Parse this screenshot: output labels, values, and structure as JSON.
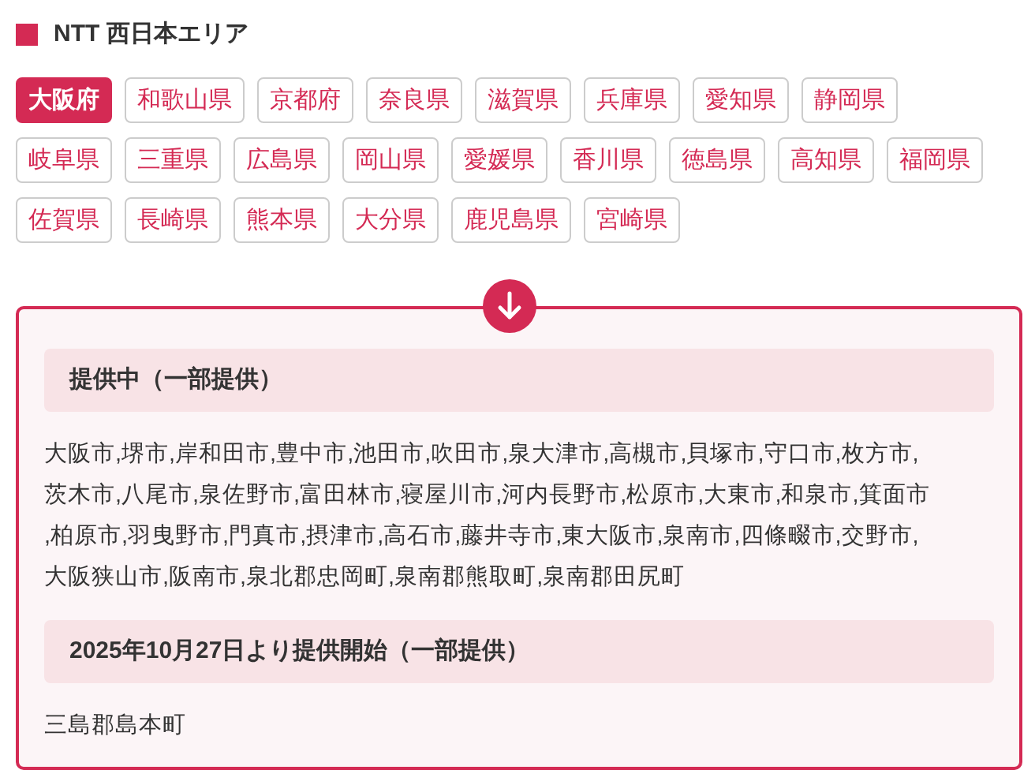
{
  "heading": "NTT 西日本エリア",
  "prefectures": [
    {
      "label": "大阪府",
      "selected": true
    },
    {
      "label": "和歌山県",
      "selected": false
    },
    {
      "label": "京都府",
      "selected": false
    },
    {
      "label": "奈良県",
      "selected": false
    },
    {
      "label": "滋賀県",
      "selected": false
    },
    {
      "label": "兵庫県",
      "selected": false
    },
    {
      "label": "愛知県",
      "selected": false
    },
    {
      "label": "静岡県",
      "selected": false
    },
    {
      "label": "岐阜県",
      "selected": false
    },
    {
      "label": "三重県",
      "selected": false
    },
    {
      "label": "広島県",
      "selected": false
    },
    {
      "label": "岡山県",
      "selected": false
    },
    {
      "label": "愛媛県",
      "selected": false
    },
    {
      "label": "香川県",
      "selected": false
    },
    {
      "label": "徳島県",
      "selected": false
    },
    {
      "label": "高知県",
      "selected": false
    },
    {
      "label": "福岡県",
      "selected": false
    },
    {
      "label": "佐賀県",
      "selected": false
    },
    {
      "label": "長崎県",
      "selected": false
    },
    {
      "label": "熊本県",
      "selected": false
    },
    {
      "label": "大分県",
      "selected": false
    },
    {
      "label": "鹿児島県",
      "selected": false
    },
    {
      "label": "宮崎県",
      "selected": false
    }
  ],
  "sections": [
    {
      "title": "提供中（一部提供）",
      "lines": [
        "大阪市,堺市,岸和田市,豊中市,池田市,吹田市,泉大津市,高槻市,貝塚市,守口市,枚方市,",
        "茨木市,八尾市,泉佐野市,富田林市,寝屋川市,河内長野市,松原市,大東市,和泉市,箕面市",
        ",柏原市,羽曳野市,門真市,摂津市,高石市,藤井寺市,東大阪市,泉南市,四條畷市,交野市,",
        "大阪狭山市,阪南市,泉北郡忠岡町,泉南郡熊取町,泉南郡田尻町"
      ]
    },
    {
      "title": "2025年10月27日より提供開始（一部提供）",
      "lines": [
        "三島郡島本町"
      ]
    }
  ]
}
